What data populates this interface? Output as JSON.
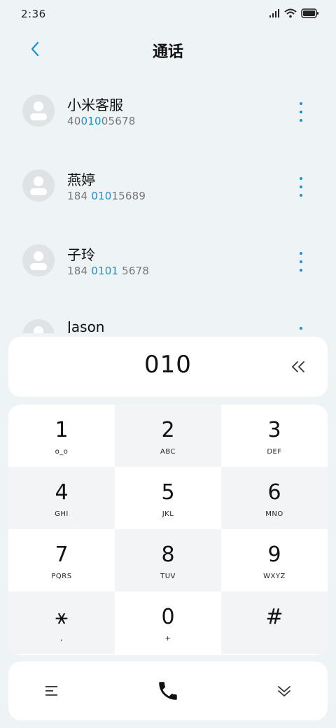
{
  "status_bar": {
    "time": "2:36"
  },
  "header": {
    "title": "通话"
  },
  "contacts": [
    {
      "name": "小米客服",
      "number_prefix": "40",
      "number_match": "010",
      "number_suffix": "05678"
    },
    {
      "name": "燕婷",
      "number_prefix": "184 ",
      "number_match": "010",
      "number_suffix": "15689"
    },
    {
      "name": "子玲",
      "number_prefix": "184 ",
      "number_match": "0101",
      "number_suffix": " 5678"
    },
    {
      "name": "Jason",
      "number_prefix": "",
      "number_match": "",
      "number_suffix": ""
    }
  ],
  "dialer": {
    "entered_number": "010"
  },
  "keypad": [
    {
      "num": "1",
      "sub": "o_o"
    },
    {
      "num": "2",
      "sub": "ABC"
    },
    {
      "num": "3",
      "sub": "DEF"
    },
    {
      "num": "4",
      "sub": "GHI"
    },
    {
      "num": "5",
      "sub": "JKL"
    },
    {
      "num": "6",
      "sub": "MNO"
    },
    {
      "num": "7",
      "sub": "PQRS"
    },
    {
      "num": "8",
      "sub": "TUV"
    },
    {
      "num": "9",
      "sub": "WXYZ"
    },
    {
      "num": "⚹",
      "sub": ","
    },
    {
      "num": "0",
      "sub": "+"
    },
    {
      "num": "#",
      "sub": ""
    }
  ],
  "icons": {
    "back": "chevron-left-icon",
    "more": "more-vertical-icon",
    "delete": "backspace-double-chevron-icon",
    "menu": "menu-icon",
    "call": "phone-icon",
    "collapse": "double-chevron-down-icon"
  },
  "colors": {
    "accent": "#1a91d1",
    "background": "#eef3f6",
    "card": "#ffffff"
  }
}
